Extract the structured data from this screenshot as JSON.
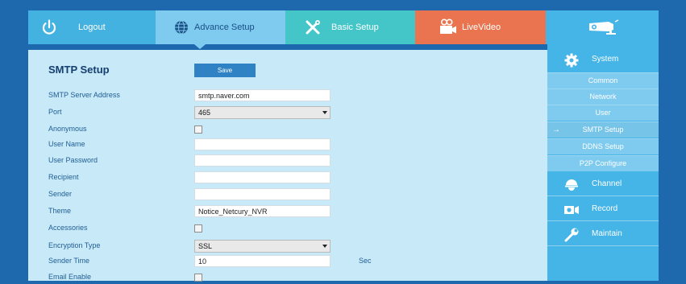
{
  "topnav": {
    "logout": "Logout",
    "advance_setup": "Advance Setup",
    "basic_setup": "Basic Setup",
    "live_video": "LiveVideo"
  },
  "page": {
    "title": "SMTP Setup",
    "save_label": "Save"
  },
  "form": {
    "server_label": "SMTP Server Address",
    "server_value": "smtp.naver.com",
    "port_label": "Port",
    "port_value": "465",
    "anonymous_label": "Anonymous",
    "username_label": "User Name",
    "username_value": "",
    "password_label": "User Password",
    "password_value": "",
    "recipient_label": "Recipient",
    "recipient_value": "",
    "sender_label": "Sender",
    "sender_value": "",
    "theme_label": "Theme",
    "theme_value": "Notice_Netcury_NVR",
    "accessories_label": "Accessories",
    "encryption_label": "Encryption Type",
    "encryption_value": "SSL",
    "sender_time_label": "Sender Time",
    "sender_time_value": "10",
    "sender_time_unit": "Sec",
    "email_enable_label": "Email Enable"
  },
  "sidebar": {
    "system": "System",
    "items": [
      "Common",
      "Network",
      "User",
      "SMTP Setup",
      "DDNS Setup",
      "P2P Configure"
    ],
    "active_arrow": "→",
    "channel": "Channel",
    "record": "Record",
    "maintain": "Maintain"
  },
  "colors": {
    "background": "#1e68ae",
    "logout_tab": "#43b2e0",
    "advance_tab": "#7fcbef",
    "basic_tab": "#44c6c9",
    "live_tab": "#e9744f",
    "sidebar": "#45b4e6",
    "content": "#c8e9f8"
  },
  "icons": {
    "logout": "power-icon",
    "advance": "globe-icon",
    "basic": "tools-icon",
    "live": "video-camera-icon",
    "brand": "cctv-camera-icon",
    "system": "gear-icon",
    "channel": "dome-camera-icon",
    "record": "record-camera-icon",
    "maintain": "wrench-icon"
  }
}
